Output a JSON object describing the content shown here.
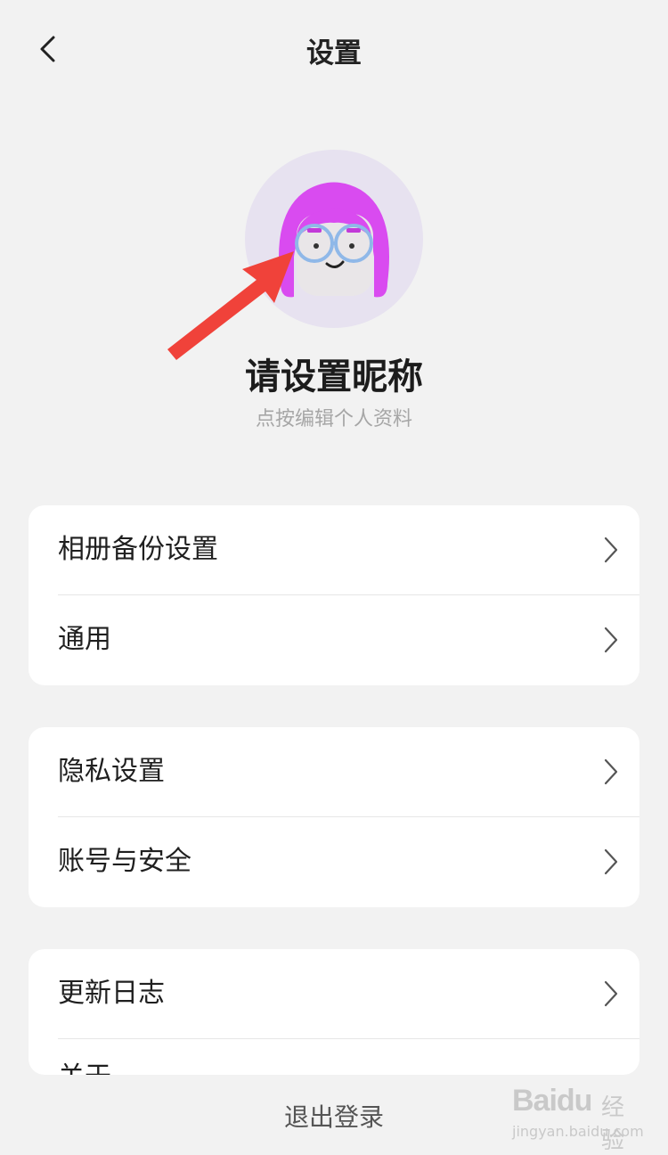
{
  "header": {
    "title": "设置",
    "back_icon": "chevron-left-icon"
  },
  "profile": {
    "nickname": "请设置昵称",
    "subtitle": "点按编辑个人资料",
    "avatar_icon": "cartoon-avatar-icon"
  },
  "cards": [
    {
      "items": [
        {
          "label": "相册备份设置"
        },
        {
          "label": "通用"
        }
      ]
    },
    {
      "items": [
        {
          "label": "隐私设置"
        },
        {
          "label": "账号与安全"
        }
      ]
    },
    {
      "items": [
        {
          "label": "更新日志"
        },
        {
          "label": "关于"
        }
      ]
    }
  ],
  "footer": {
    "logout_label": "退出登录"
  },
  "watermark": {
    "logo": "Baidu",
    "suffix": "经验",
    "url": "jingyan.baidu.com"
  },
  "colors": {
    "background": "#f2f2f2",
    "card": "#ffffff",
    "arrow": "#f0423a",
    "avatar_hair": "#d94bf0"
  }
}
